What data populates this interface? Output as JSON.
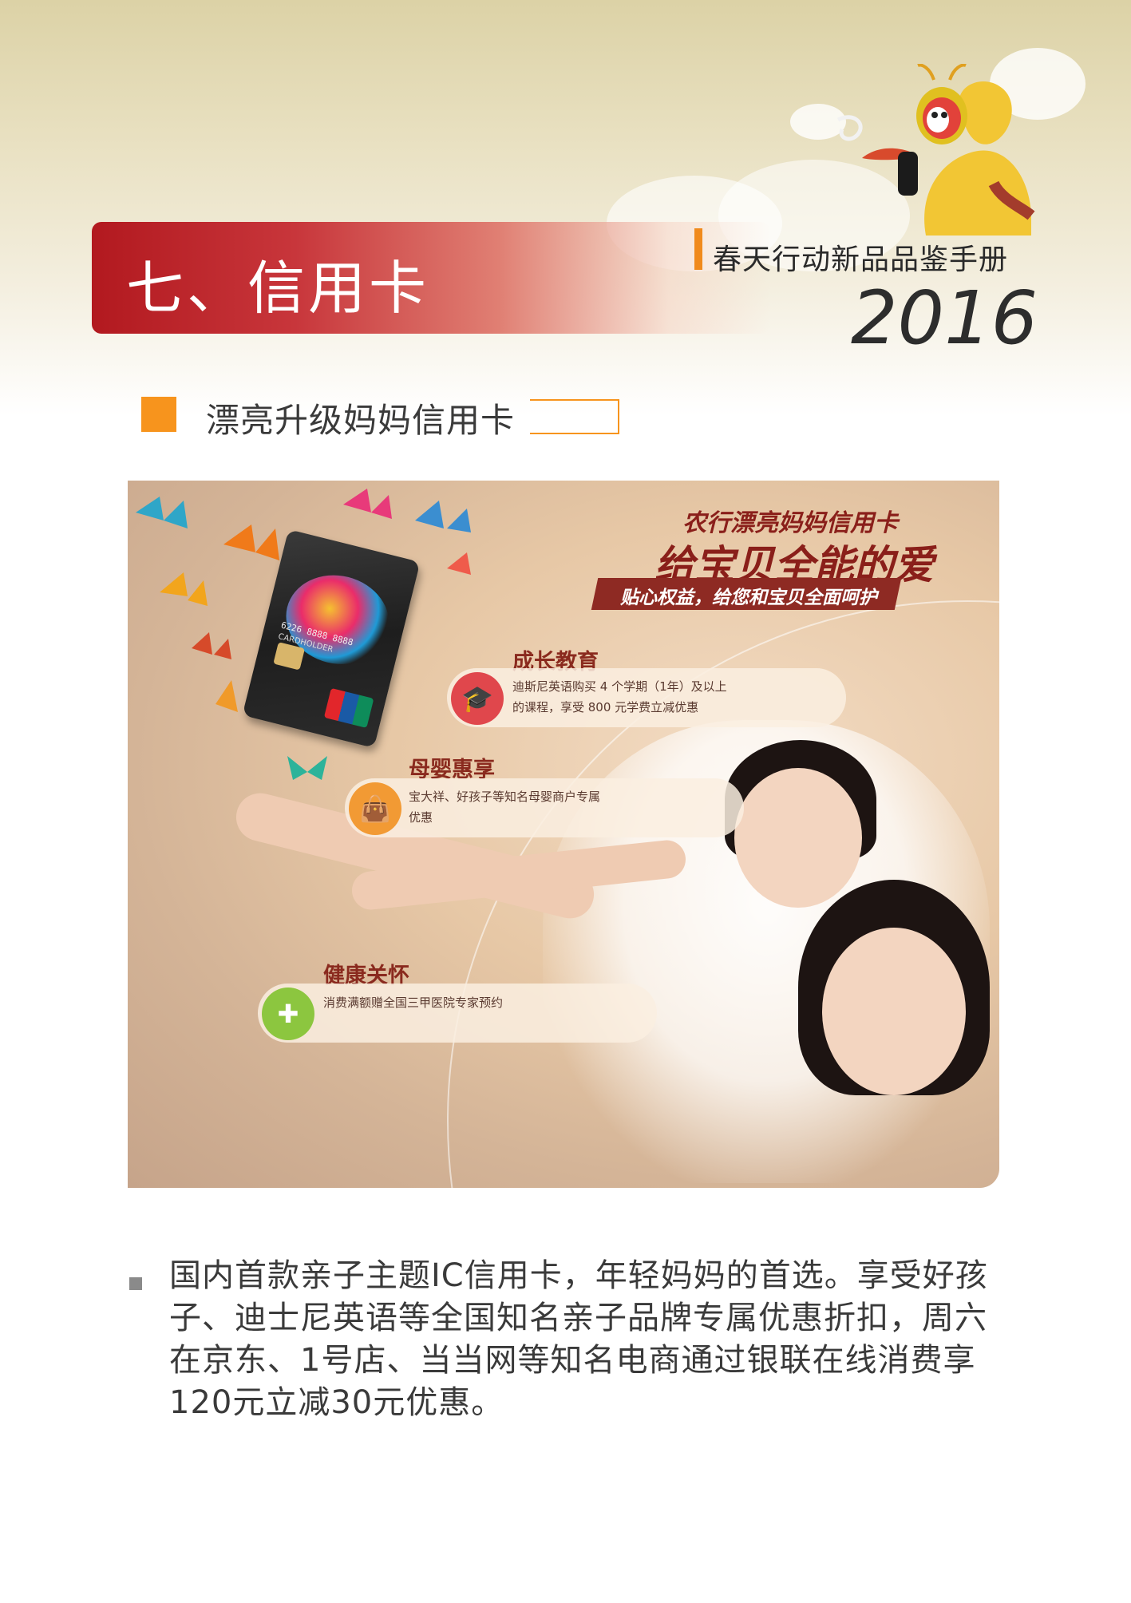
{
  "header": {
    "section_title": "七、信用卡",
    "handbook_title": "春天行动新品品鉴手册",
    "year": "2016"
  },
  "subsection": {
    "title": "漂亮升级妈妈信用卡"
  },
  "hero": {
    "banner_top": "农行漂亮妈妈信用卡",
    "banner_main": "给宝贝全能的爱",
    "banner_sub": "贴心权益，给您和宝贝全面呵护",
    "card": {
      "number": "6226 8888 8888",
      "holder": "CARDHOLDER"
    },
    "benefits": [
      {
        "title": "成长教育",
        "text": "迪斯尼英语购买 4 个学期（1年）及以上的课程，享受 800 元学费立减优惠",
        "icon": "graduation-cap-icon",
        "color": "#e0474c"
      },
      {
        "title": "母婴惠享",
        "text": "宝大祥、好孩子等知名母婴商户专属优惠",
        "icon": "shopping-bag-icon",
        "color": "#f29a34"
      },
      {
        "title": "健康关怀",
        "text": "消费满额赠全国三甲医院专家预约",
        "icon": "medical-kit-icon",
        "color": "#8cc63f"
      }
    ]
  },
  "body": {
    "paragraph": "国内首款亲子主题IC信用卡，年轻妈妈的首选。享受好孩子、迪士尼英语等全国知名亲子品牌专属优惠折扣，周六在京东、1号店、当当网等知名电商通过银联在线消费享120元立减30元优惠。"
  },
  "colors": {
    "brand_red": "#b2191f",
    "accent_orange": "#f7941d"
  }
}
